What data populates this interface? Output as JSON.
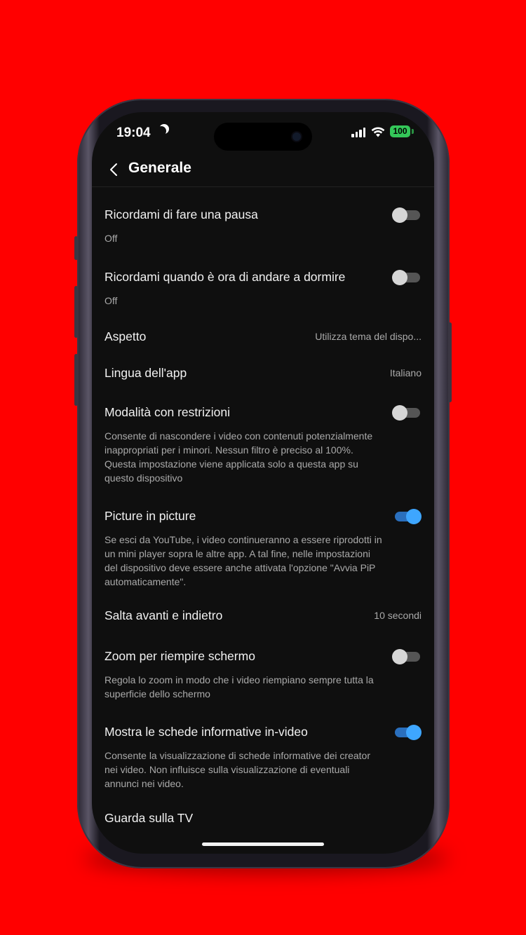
{
  "status_bar": {
    "time": "19:04",
    "battery": "100"
  },
  "header": {
    "title": "Generale"
  },
  "settings": [
    {
      "label": "Ricordami di fare una pausa",
      "sub": "Off",
      "toggle": "off"
    },
    {
      "label": "Ricordami quando è ora di andare a dormire",
      "sub": "Off",
      "toggle": "off"
    },
    {
      "label": "Aspetto",
      "value": "Utilizza tema del dispo..."
    },
    {
      "label": "Lingua dell'app",
      "value": "Italiano"
    },
    {
      "label": "Modalità con restrizioni",
      "sub": "Consente di nascondere i video con contenuti potenzialmente inappropriati per i minori. Nessun filtro è preciso al 100%. Questa impostazione viene applicata solo a questa app su questo dispositivo",
      "toggle": "off"
    },
    {
      "label": "Picture in picture",
      "sub": "Se esci da YouTube, i video continueranno a essere riprodotti in un mini player sopra le altre app. A tal fine, nelle impostazioni del dispositivo deve essere anche attivata l'opzione \"Avvia PiP automaticamente\".",
      "toggle": "on"
    },
    {
      "label": "Salta avanti e indietro",
      "value": "10 secondi"
    },
    {
      "label": "Zoom per riempire schermo",
      "sub": "Regola lo zoom in modo che i video riempiano sempre tutta la superficie dello schermo",
      "toggle": "off"
    },
    {
      "label": "Mostra le schede informative in-video",
      "sub": "Consente la visualizzazione di schede informative dei creator nei video. Non influisce sulla visualizzazione di eventuali annunci nei video.",
      "toggle": "on"
    },
    {
      "label": "Guarda sulla TV"
    }
  ],
  "colors": {
    "background": "#ff0000",
    "screen": "#0f0f0f",
    "toggle_on": "#3ea6ff",
    "battery": "#34c759"
  }
}
